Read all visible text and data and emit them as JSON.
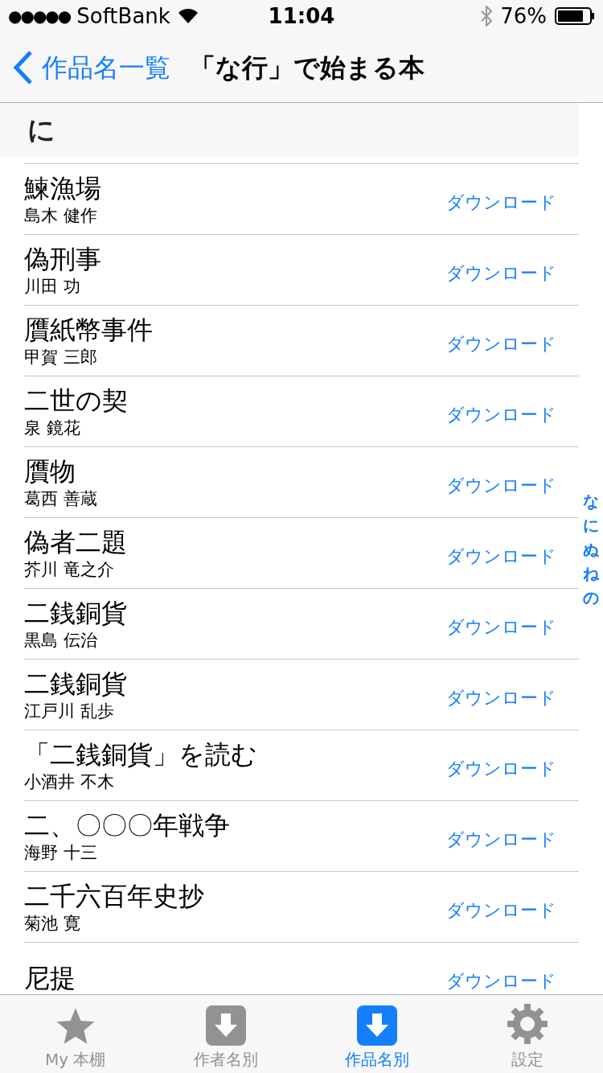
{
  "status_bar": {
    "signal": "●●●●●",
    "carrier": "SoftBank",
    "time": "11:04",
    "battery": "76%"
  },
  "nav": {
    "back": "作品名一覧",
    "title": "「な行」で始まる本"
  },
  "section": {
    "header": "に"
  },
  "rows": [
    {
      "title": "鰊漁場",
      "author": "島木 健作",
      "action": "ダウンロード"
    },
    {
      "title": "偽刑事",
      "author": "川田 功",
      "action": "ダウンロード"
    },
    {
      "title": "贋紙幣事件",
      "author": "甲賀 三郎",
      "action": "ダウンロード"
    },
    {
      "title": "二世の契",
      "author": "泉 鏡花",
      "action": "ダウンロード"
    },
    {
      "title": "贋物",
      "author": "葛西 善蔵",
      "action": "ダウンロード"
    },
    {
      "title": "偽者二題",
      "author": "芥川 竜之介",
      "action": "ダウンロード"
    },
    {
      "title": "二銭銅貨",
      "author": "黒島 伝治",
      "action": "ダウンロード"
    },
    {
      "title": "二銭銅貨",
      "author": "江戸川 乱歩",
      "action": "ダウンロード"
    },
    {
      "title": "「二銭銅貨」を読む",
      "author": "小酒井 不木",
      "action": "ダウンロード"
    },
    {
      "title": "二、〇〇〇年戦争",
      "author": "海野 十三",
      "action": "ダウンロード"
    },
    {
      "title": "二千六百年史抄",
      "author": "菊池 寛",
      "action": "ダウンロード"
    },
    {
      "title": "尼提",
      "action": "ダウンロード"
    }
  ],
  "index": [
    "な",
    "に",
    "ぬ",
    "ね",
    "の"
  ],
  "tabs": [
    {
      "kind": "star",
      "label": "My 本棚",
      "selected": false
    },
    {
      "kind": "download",
      "label": "作者名別",
      "selected": false
    },
    {
      "kind": "download",
      "label": "作品名別",
      "selected": true
    },
    {
      "kind": "gear",
      "label": "設定",
      "selected": false
    }
  ]
}
